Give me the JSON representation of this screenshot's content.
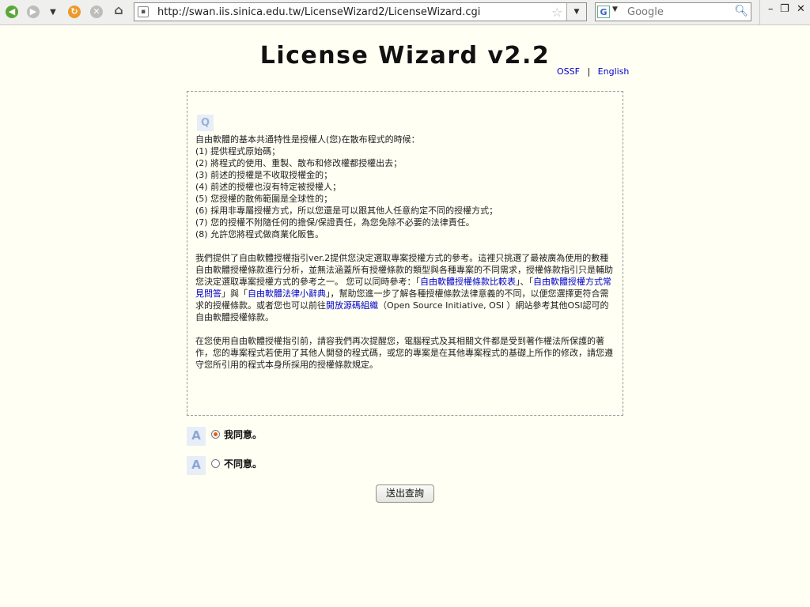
{
  "browser": {
    "url": "http://swan.iis.sinica.edu.tw/LicenseWizard2/LicenseWizard.cgi",
    "search_placeholder": "Google"
  },
  "page": {
    "title": "License Wizard v2.2",
    "lang_links": [
      "OSSF",
      "English"
    ],
    "question_lines": [
      "自由軟體的基本共通特性是授權人(您)在散布程式的時候：",
      "(1) 提供程式原始碼；",
      "(2) 將程式的使用、重製、散布和修改權都授權出去；",
      "(3) 前述的授權是不收取授權金的；",
      "(4) 前述的授權也沒有特定被授權人；",
      "(5) 您授權的散佈範圍是全球性的；",
      "(6) 採用非專屬授權方式，所以您還是可以跟其他人任意約定不同的授權方式；",
      "(7) 您的授權不附隨任何的擔保/保證責任，為您免除不必要的法律責任。",
      "(8) 允許您將程式做商業化販售。"
    ],
    "para2": {
      "t1": "我們提供了自由軟體授權指引ver.2提供您決定選取專案授權方式的參考。這裡只挑選了最被廣為使用的數種自由軟體授權條款進行分析，並無法涵蓋所有授權條款的類型與各種專案的不同需求，授權條款指引只是輔助您決定選取專案授權方式的參考之一。 您可以同時參考：「",
      "link1": "自由軟體授權條款比較表",
      "t2": "」、「",
      "link2": "自由軟體授權方式常見問答",
      "t3": "」與「",
      "link3": "自由軟體法律小辭典",
      "t4": "」，幫助您進一步了解各種授權條款法律意義的不同，以便您選擇更符合需求的授權條款。或者您也可以前往",
      "link4": "開放源碼組織",
      "t5": "（Open Source Initiative, OSI ）網站參考其他OSI認可的自由軟體授權條款。"
    },
    "para3": "在您使用自由軟體授權指引前，請容我們再次提醒您，電腦程式及其相關文件都是受到著作權法所保護的著作，您的專案程式若使用了其他人開發的程式碼，或您的專案是在其他專案程式的基礎上所作的修改，請您遵守您所引用的程式本身所採用的授權條款規定。",
    "answers": [
      {
        "label": "我同意。",
        "selected": true
      },
      {
        "label": "不同意。",
        "selected": false
      }
    ],
    "submit_label": "送出查詢"
  },
  "icons": {
    "q_icon": "Q",
    "a_icon": "A"
  }
}
